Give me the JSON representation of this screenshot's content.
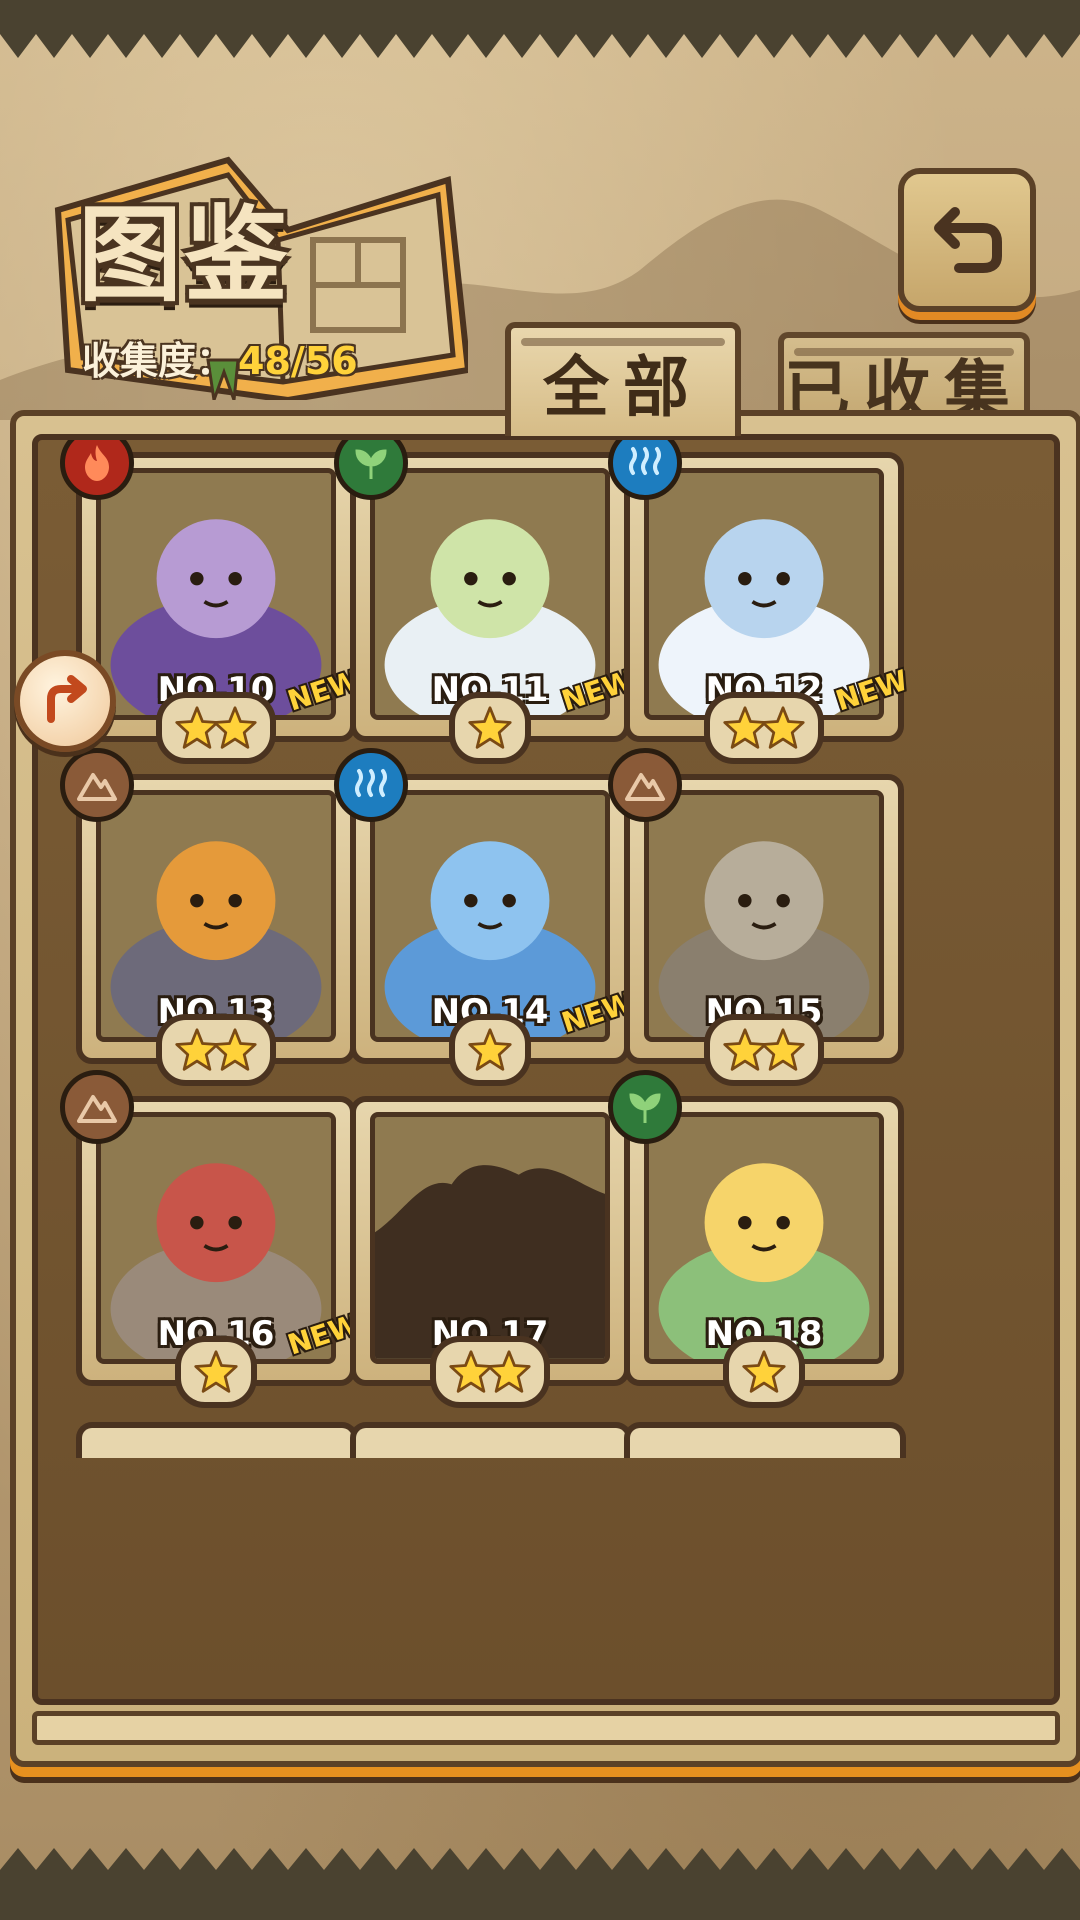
{
  "header": {
    "title": "图鉴",
    "collection_label": "收集度：",
    "collection_value": "48/56"
  },
  "tabs": [
    {
      "label": "全部",
      "active": true
    },
    {
      "label": "已收集",
      "active": false
    }
  ],
  "buttons": {
    "back_icon": "return-arrow-icon",
    "side_arrow_icon": "share-arrow-icon"
  },
  "cards": [
    {
      "number": "NO.10",
      "stars": 2,
      "new": true,
      "element": "fire",
      "new_label": "NEW",
      "silhouette": false
    },
    {
      "number": "NO.11",
      "stars": 1,
      "new": true,
      "element": "leaf",
      "new_label": "NEW",
      "silhouette": false
    },
    {
      "number": "NO.12",
      "stars": 2,
      "new": true,
      "element": "water",
      "new_label": "NEW",
      "silhouette": false
    },
    {
      "number": "NO.13",
      "stars": 2,
      "new": false,
      "element": "earth",
      "new_label": "",
      "silhouette": false
    },
    {
      "number": "NO.14",
      "stars": 1,
      "new": true,
      "element": "water",
      "new_label": "NEW",
      "silhouette": false
    },
    {
      "number": "NO.15",
      "stars": 2,
      "new": false,
      "element": "earth",
      "new_label": "",
      "silhouette": false
    },
    {
      "number": "NO.16",
      "stars": 1,
      "new": true,
      "element": "earth",
      "new_label": "NEW",
      "silhouette": false
    },
    {
      "number": "NO.17",
      "stars": 2,
      "new": false,
      "element": "",
      "new_label": "",
      "silhouette": true
    },
    {
      "number": "NO.18",
      "stars": 1,
      "new": false,
      "element": "leaf",
      "new_label": "",
      "silhouette": false
    }
  ],
  "colors": {
    "accent_gold": "#ffd23a",
    "frame_brown": "#4a3320",
    "parchment": "#e7d6ad",
    "orange_glow": "#e6901f"
  }
}
